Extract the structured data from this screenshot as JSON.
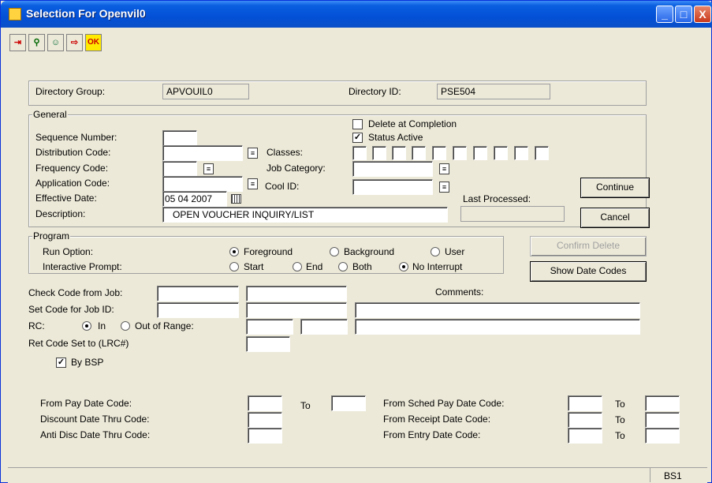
{
  "window": {
    "title": "Selection For Openvil0",
    "minimize": "_",
    "maximize": "□",
    "close": "X"
  },
  "toolbar": {
    "items": [
      {
        "name": "exit-icon",
        "glyph": "⇥"
      },
      {
        "name": "tree-icon",
        "glyph": "⚲"
      },
      {
        "name": "people-icon",
        "glyph": "☺"
      },
      {
        "name": "door-icon",
        "glyph": "⇨"
      },
      {
        "name": "ok-icon",
        "glyph": "OK"
      }
    ]
  },
  "directory": {
    "group_label": "Directory Group:",
    "group_value": "APVOUIL0",
    "id_label": "Directory ID:",
    "id_value": "PSE504"
  },
  "general": {
    "title": "General",
    "sequence_label": "Sequence Number:",
    "distribution_label": "Distribution Code:",
    "frequency_label": "Frequency Code:",
    "application_label": "Application Code:",
    "effective_label": "Effective Date:",
    "effective_value": "05  04  2007",
    "description_label": "Description:",
    "description_value": "OPEN VOUCHER INQUIRY/LIST",
    "delete_label": "Delete at Completion",
    "delete_checked": false,
    "status_label": "Status Active",
    "status_checked": true,
    "classes_label": "Classes:",
    "job_category_label": "Job Category:",
    "cool_id_label": "Cool ID:",
    "last_processed_label": "Last Processed:"
  },
  "program": {
    "title": "Program",
    "run_label": "Run Option:",
    "run_options": [
      "Foreground",
      "Background",
      "User"
    ],
    "run_selected": "Foreground",
    "prompt_label": "Interactive Prompt:",
    "prompt_options": [
      "Start",
      "End",
      "Both",
      "No Interrupt"
    ],
    "prompt_selected": "No Interrupt"
  },
  "buttons": {
    "continue": "Continue",
    "cancel": "Cancel",
    "confirm_delete": "Confirm Delete",
    "show_date_codes": "Show Date Codes"
  },
  "codes": {
    "check_label": "Check Code from Job:",
    "set_label": "Set Code for Job ID:",
    "rc_label": "RC:",
    "rc_in": "In",
    "rc_out": "Out of Range:",
    "rc_selected": "In",
    "ret_label": "Ret Code Set to (LRC#)",
    "comments_label": "Comments:",
    "bybsp_label": "By BSP",
    "bybsp_checked": true
  },
  "dates": {
    "from_pay": "From Pay Date Code:",
    "to1": "To",
    "discount": "Discount Date Thru Code:",
    "anti": "Anti Disc Date Thru Code:",
    "from_sched": "From Sched Pay Date Code:",
    "from_receipt": "From Receipt Date Code:",
    "from_entry": "From Entry Date Code:",
    "to": "To"
  },
  "status": {
    "text": "BS1"
  }
}
